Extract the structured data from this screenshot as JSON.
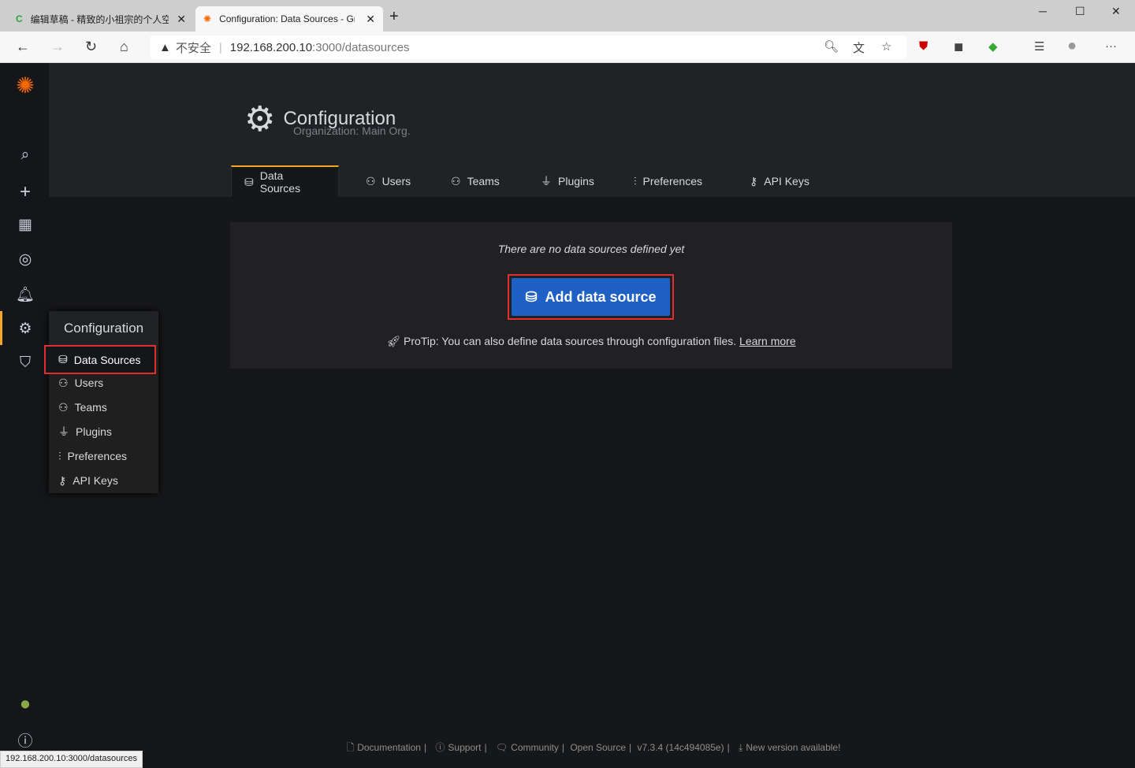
{
  "browser": {
    "tabs": [
      {
        "title": "编辑草稿 - 精致的小祖宗的个人空"
      },
      {
        "title": "Configuration: Data Sources - Grafana"
      }
    ],
    "security": "不安全",
    "url_host": "192.168.200.10",
    "url_path": ":3000/datasources",
    "status_url": "192.168.200.10:3000/datasources"
  },
  "page": {
    "title": "Configuration",
    "subtitle": "Organization: Main Org.",
    "tabs": [
      {
        "label": "Data Sources",
        "icon": "database-icon"
      },
      {
        "label": "Users",
        "icon": "user-icon"
      },
      {
        "label": "Teams",
        "icon": "users-icon"
      },
      {
        "label": "Plugins",
        "icon": "plug-icon"
      },
      {
        "label": "Preferences",
        "icon": "sliders-icon"
      },
      {
        "label": "API Keys",
        "icon": "key-icon"
      }
    ]
  },
  "empty": {
    "message": "There are no data sources defined yet",
    "button": "Add data source",
    "protip": "ProTip: You can also define data sources through configuration files.",
    "learn_more": "Learn more"
  },
  "flyout": {
    "title": "Configuration",
    "items": [
      "Data Sources",
      "Users",
      "Teams",
      "Plugins",
      "Preferences",
      "API Keys"
    ]
  },
  "footer": {
    "items": [
      "Documentation",
      "Support",
      "Community",
      "Open Source",
      "v7.3.4 (14c494085e)",
      "New version available!"
    ]
  },
  "colors": {
    "accent": "#f5a623",
    "primary": "#1f60c4",
    "highlight": "#e02f2f"
  }
}
